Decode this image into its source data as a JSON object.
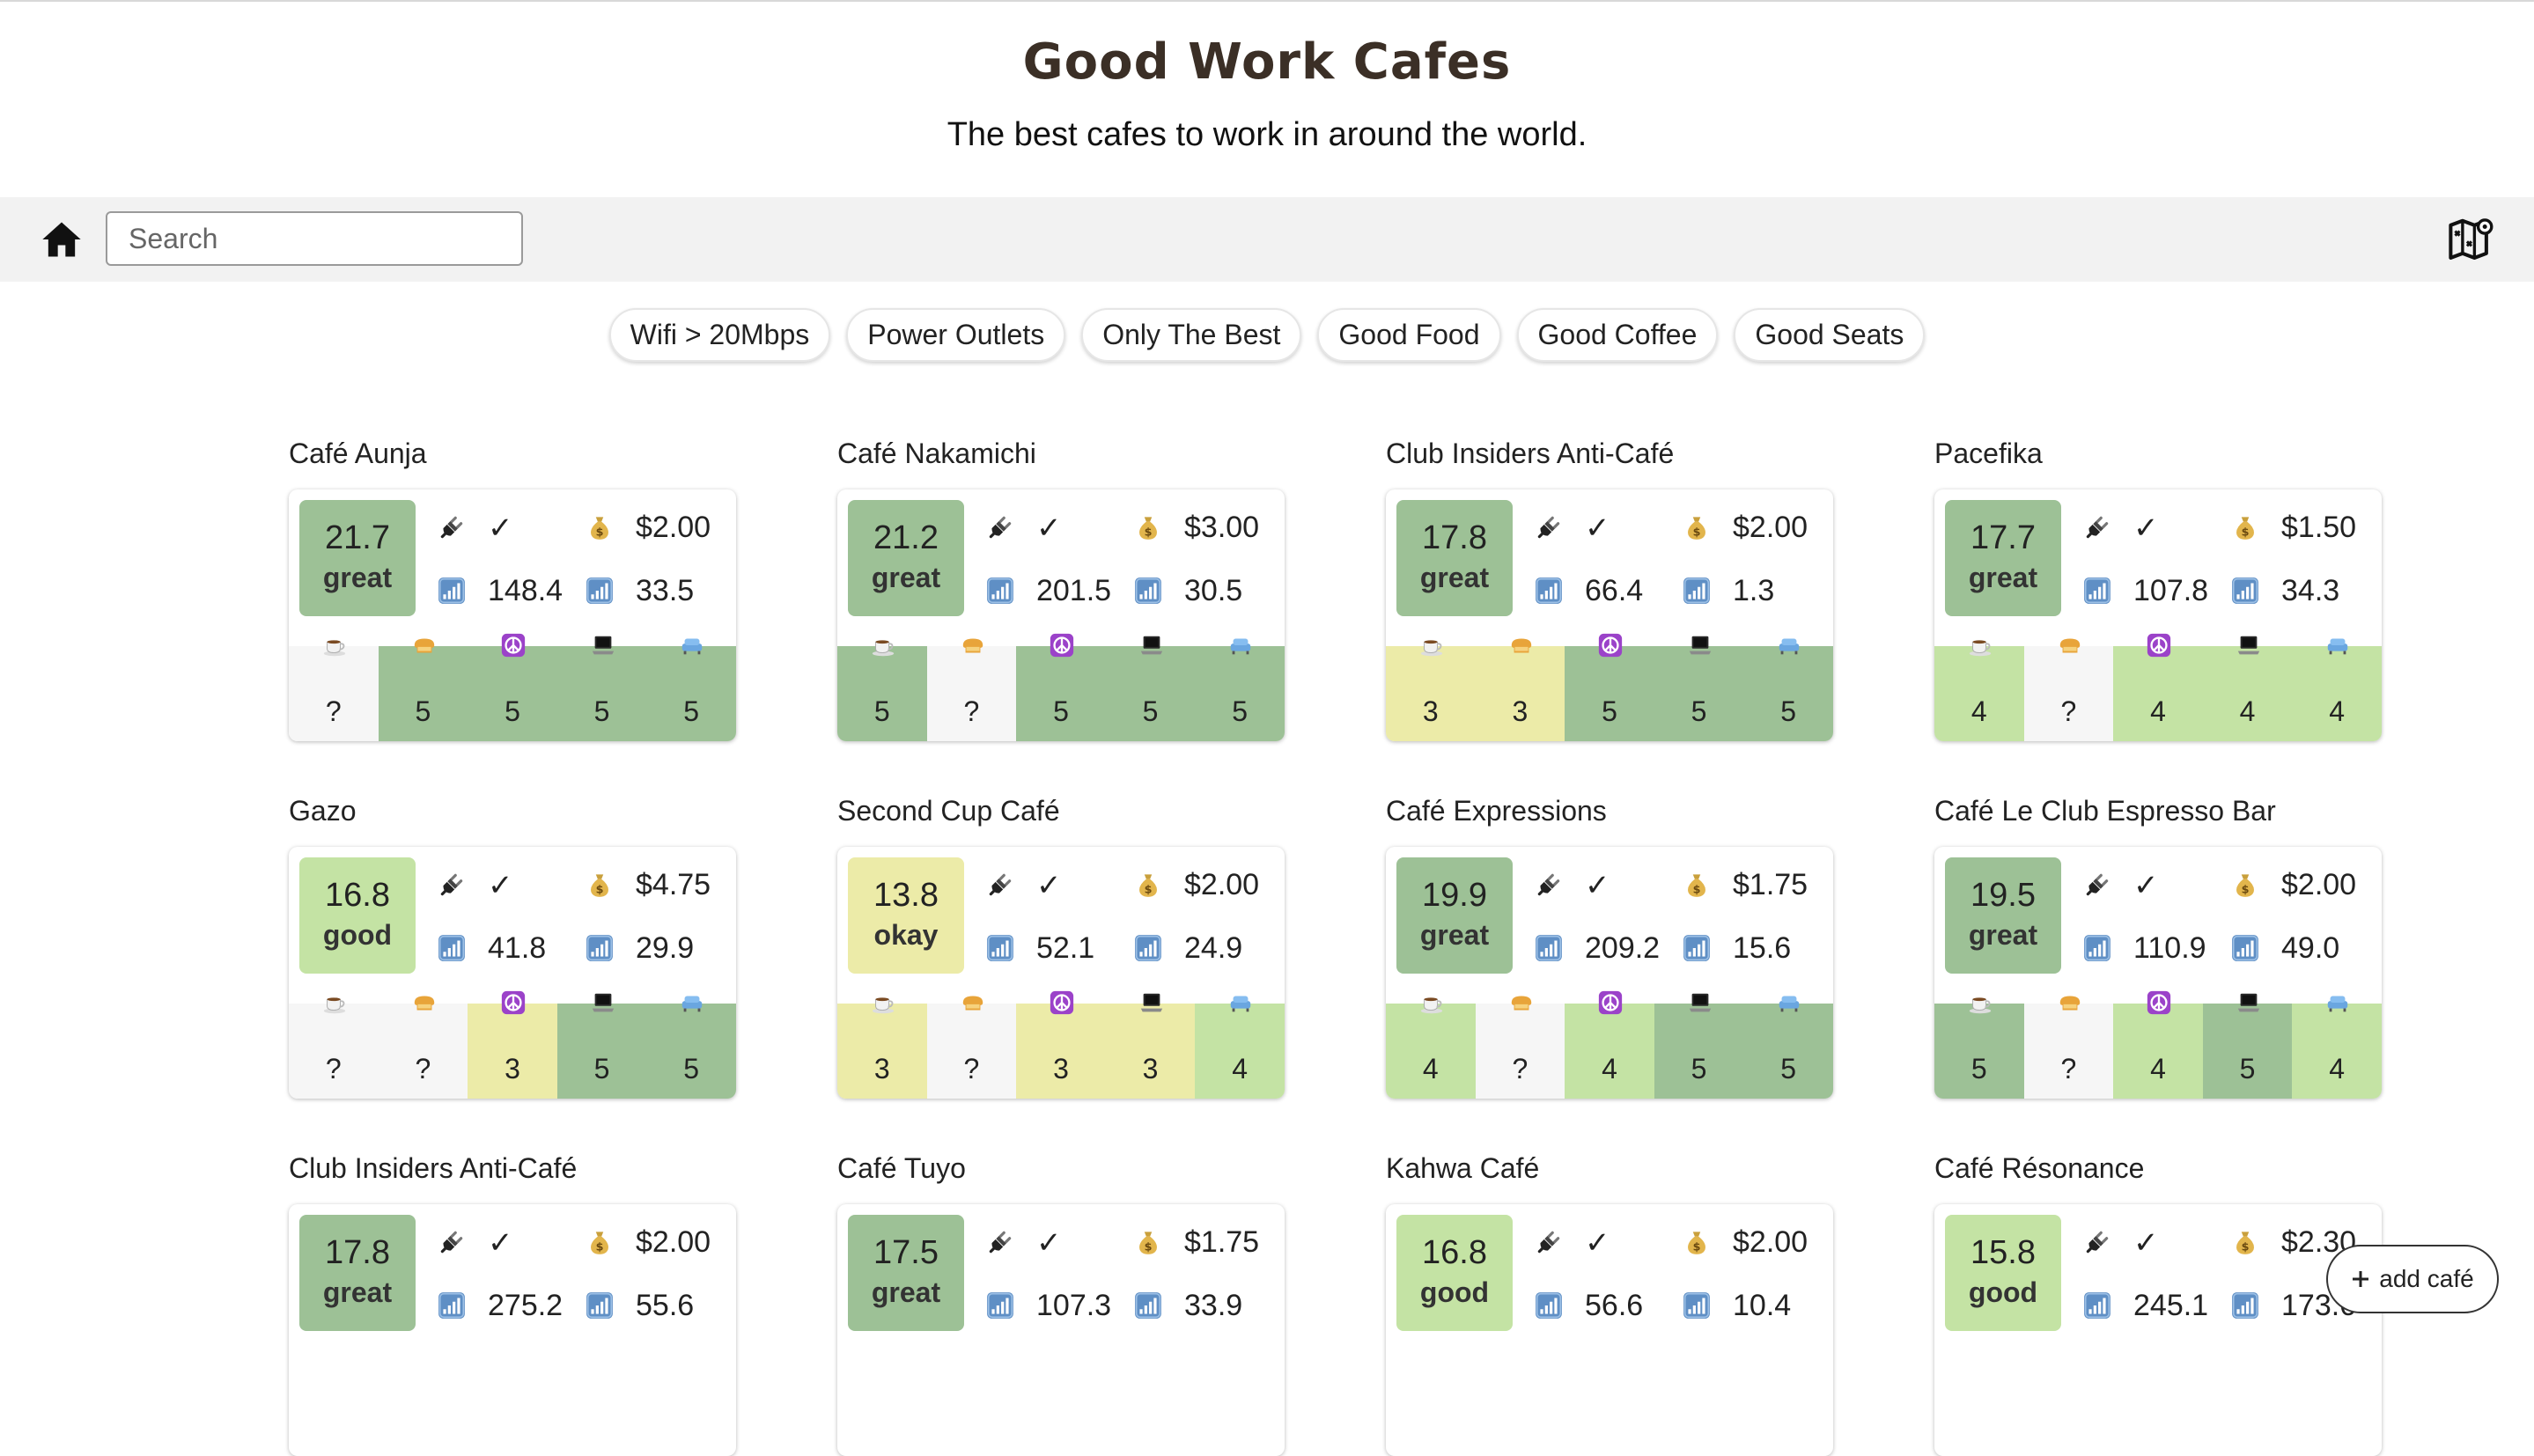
{
  "header": {
    "title": "Good Work Cafes",
    "subtitle": "The best cafes to work in around the world."
  },
  "nav": {
    "search_placeholder": "Search",
    "search_value": ""
  },
  "filters": [
    "Wifi > 20Mbps",
    "Power Outlets",
    "Only The Best",
    "Good Food",
    "Good Coffee",
    "Good Seats"
  ],
  "colors": {
    "great": "#9dc196",
    "good": "#c4e3a4",
    "okay": "#eceba8",
    "unknown": "#f6f6f6"
  },
  "rating_icons": [
    "coffee-icon",
    "bread-icon",
    "peace-icon",
    "laptop-icon",
    "seat-icon"
  ],
  "stat_icons": [
    "power-plug-icon",
    "money-bag-icon",
    "wifi-download-icon",
    "wifi-upload-icon"
  ],
  "cafes": [
    {
      "name": "Café Aunja",
      "score": "21.7",
      "rating": "great",
      "outlets": "✓",
      "price": "$2.00",
      "download": "148.4",
      "upload": "33.5",
      "ratings": [
        "?",
        "5",
        "5",
        "5",
        "5"
      ]
    },
    {
      "name": "Café Nakamichi",
      "score": "21.2",
      "rating": "great",
      "outlets": "✓",
      "price": "$3.00",
      "download": "201.5",
      "upload": "30.5",
      "ratings": [
        "5",
        "?",
        "5",
        "5",
        "5"
      ]
    },
    {
      "name": "Club Insiders Anti-Café",
      "score": "17.8",
      "rating": "great",
      "outlets": "✓",
      "price": "$2.00",
      "download": "66.4",
      "upload": "1.3",
      "ratings": [
        "3",
        "3",
        "5",
        "5",
        "5"
      ]
    },
    {
      "name": "Pacefika",
      "score": "17.7",
      "rating": "great",
      "outlets": "✓",
      "price": "$1.50",
      "download": "107.8",
      "upload": "34.3",
      "ratings": [
        "4",
        "?",
        "4",
        "4",
        "4"
      ]
    },
    {
      "name": "Gazo",
      "score": "16.8",
      "rating": "good",
      "outlets": "✓",
      "price": "$4.75",
      "download": "41.8",
      "upload": "29.9",
      "ratings": [
        "?",
        "?",
        "3",
        "5",
        "5"
      ]
    },
    {
      "name": "Second Cup Café",
      "score": "13.8",
      "rating": "okay",
      "outlets": "✓",
      "price": "$2.00",
      "download": "52.1",
      "upload": "24.9",
      "ratings": [
        "3",
        "?",
        "3",
        "3",
        "4"
      ]
    },
    {
      "name": "Café Expressions",
      "score": "19.9",
      "rating": "great",
      "outlets": "✓",
      "price": "$1.75",
      "download": "209.2",
      "upload": "15.6",
      "ratings": [
        "4",
        "?",
        "4",
        "5",
        "5"
      ]
    },
    {
      "name": "Café Le Club Espresso Bar",
      "score": "19.5",
      "rating": "great",
      "outlets": "✓",
      "price": "$2.00",
      "download": "110.9",
      "upload": "49.0",
      "ratings": [
        "5",
        "?",
        "4",
        "5",
        "4"
      ]
    },
    {
      "name": "Club Insiders Anti-Café",
      "score": "17.8",
      "rating": "great",
      "outlets": "✓",
      "price": "$2.00",
      "download": "275.2",
      "upload": "55.6",
      "ratings": []
    },
    {
      "name": "Café Tuyo",
      "score": "17.5",
      "rating": "great",
      "outlets": "✓",
      "price": "$1.75",
      "download": "107.3",
      "upload": "33.9",
      "ratings": []
    },
    {
      "name": "Kahwa Café",
      "score": "16.8",
      "rating": "good",
      "outlets": "✓",
      "price": "$2.00",
      "download": "56.6",
      "upload": "10.4",
      "ratings": []
    },
    {
      "name": "Café Résonance",
      "score": "15.8",
      "rating": "good",
      "outlets": "✓",
      "price": "$2.30",
      "download": "245.1",
      "upload": "173.6",
      "ratings": []
    }
  ],
  "add_button": {
    "label": "add café"
  }
}
